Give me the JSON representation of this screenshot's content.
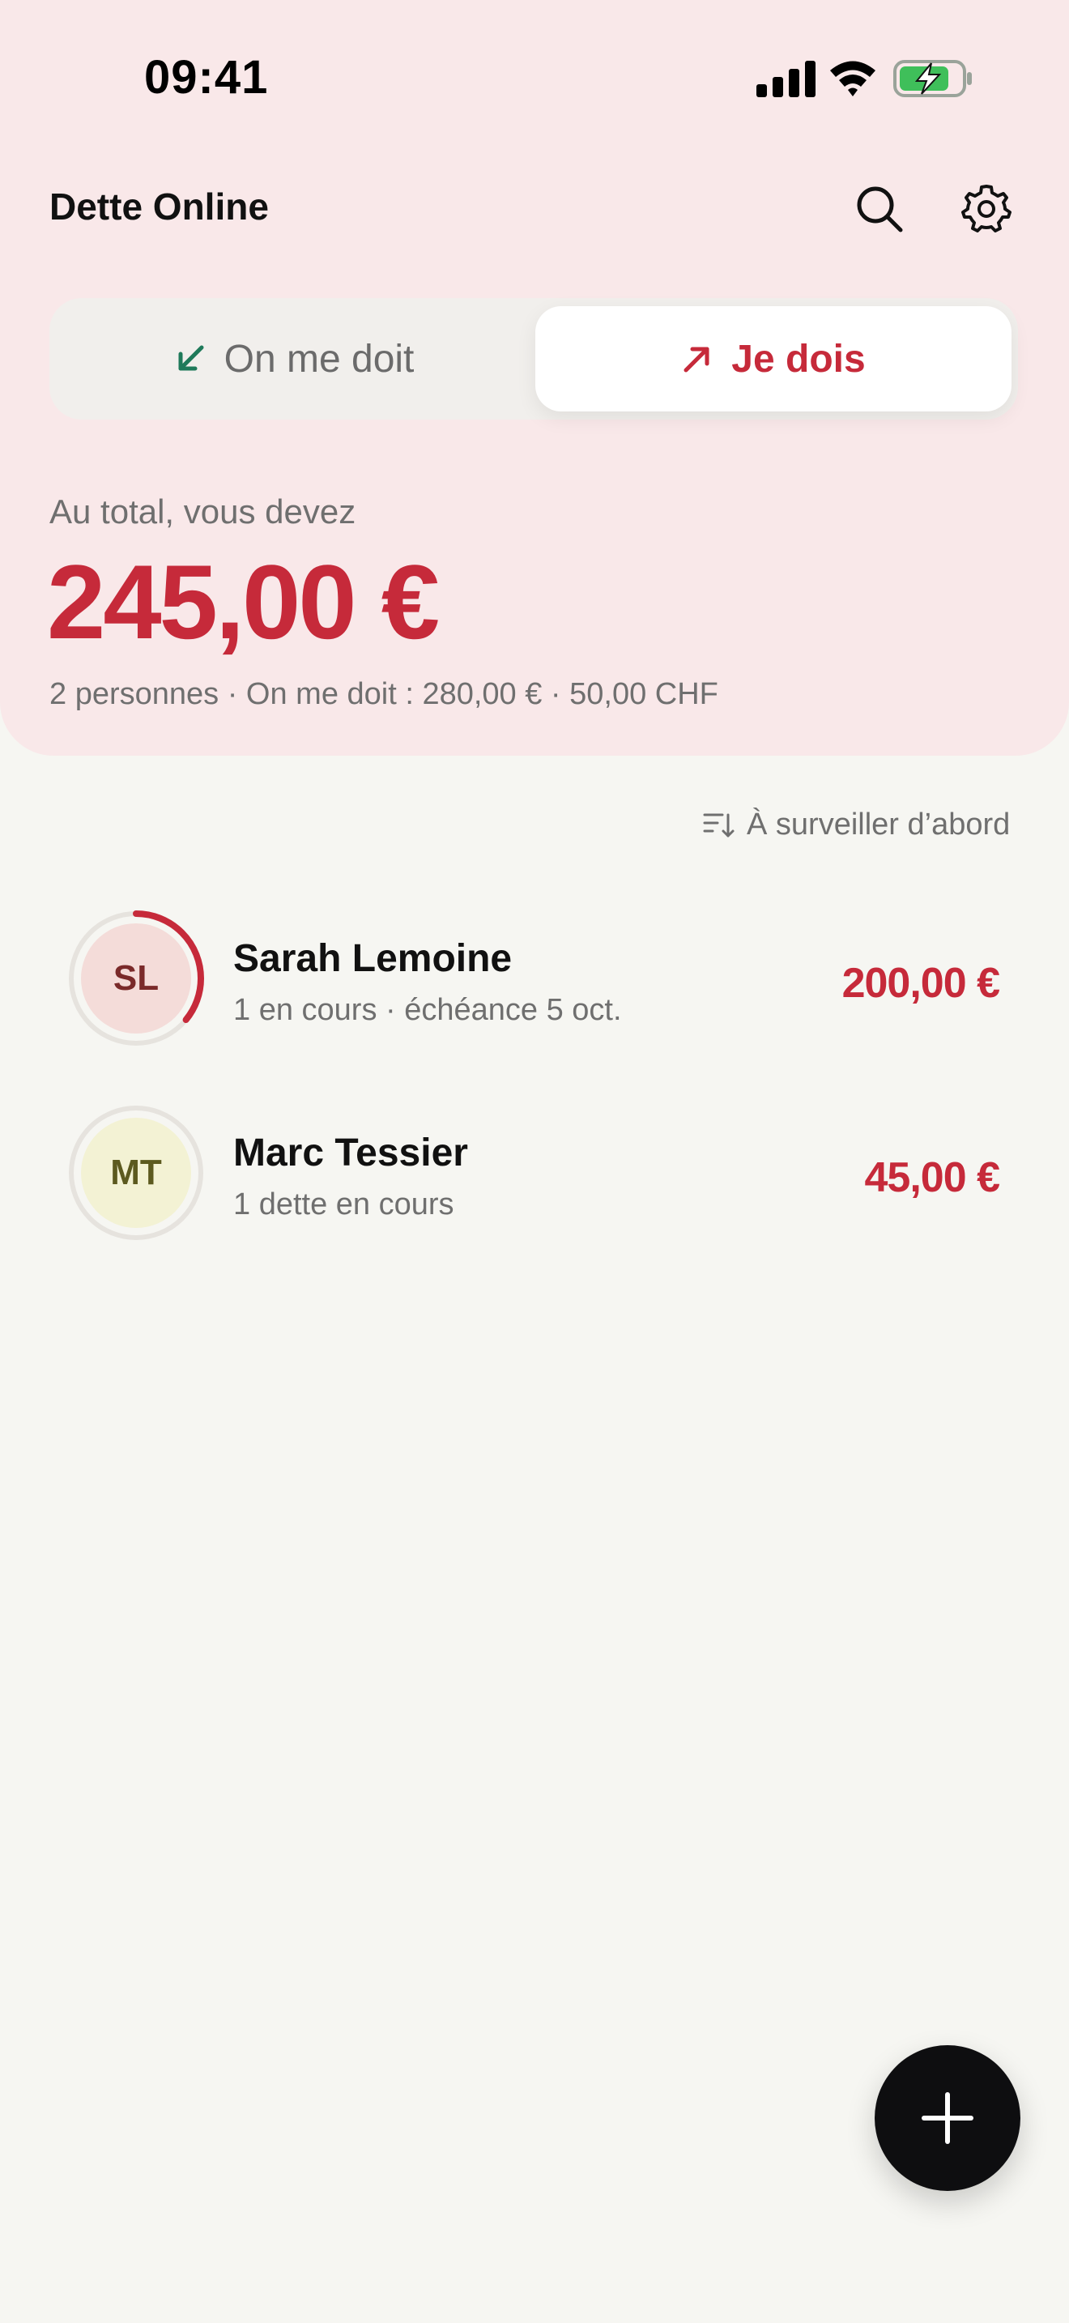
{
  "status_bar": {
    "time": "09:41",
    "icons": [
      "cellular-signal-icon",
      "wifi-icon",
      "battery-charging-icon"
    ]
  },
  "app": {
    "title": "Dette Online",
    "icons": {
      "search": "search-icon",
      "settings": "gear-icon"
    }
  },
  "segment": {
    "tabs": [
      {
        "label": "On me doit",
        "icon": "arrow-down-left-icon",
        "selected": false,
        "color": "#1f7a5a"
      },
      {
        "label": "Je dois",
        "icon": "arrow-up-right-icon",
        "selected": true,
        "color": "#c62a3a"
      }
    ]
  },
  "summary": {
    "label": "Au total, vous devez",
    "amount": "245,00 €",
    "details": "2 personnes · On me doit : 280,00 € · 50,00 CHF"
  },
  "sort": {
    "icon": "sort-icon",
    "label": "À surveiller d’abord"
  },
  "people": [
    {
      "initials": "SL",
      "name": "Sarah Lemoine",
      "subtitle": "1 en cours · échéance 5 oct.",
      "amount": "200,00 €",
      "avatar_bg": "#f4dcd9",
      "avatar_fg": "#7a2a2a",
      "progress": 0.36
    },
    {
      "initials": "MT",
      "name": "Marc Tessier",
      "subtitle": "1 dette en cours",
      "amount": "45,00 €",
      "avatar_bg": "#f3f2d4",
      "avatar_fg": "#5c5a1f",
      "progress": 0
    }
  ],
  "fab": {
    "icon": "plus-icon"
  },
  "colors": {
    "accent": "#c62a3a",
    "positive": "#1f7a5a",
    "header_bg": "#f9e8e9",
    "page_bg": "#f6f6f2"
  }
}
